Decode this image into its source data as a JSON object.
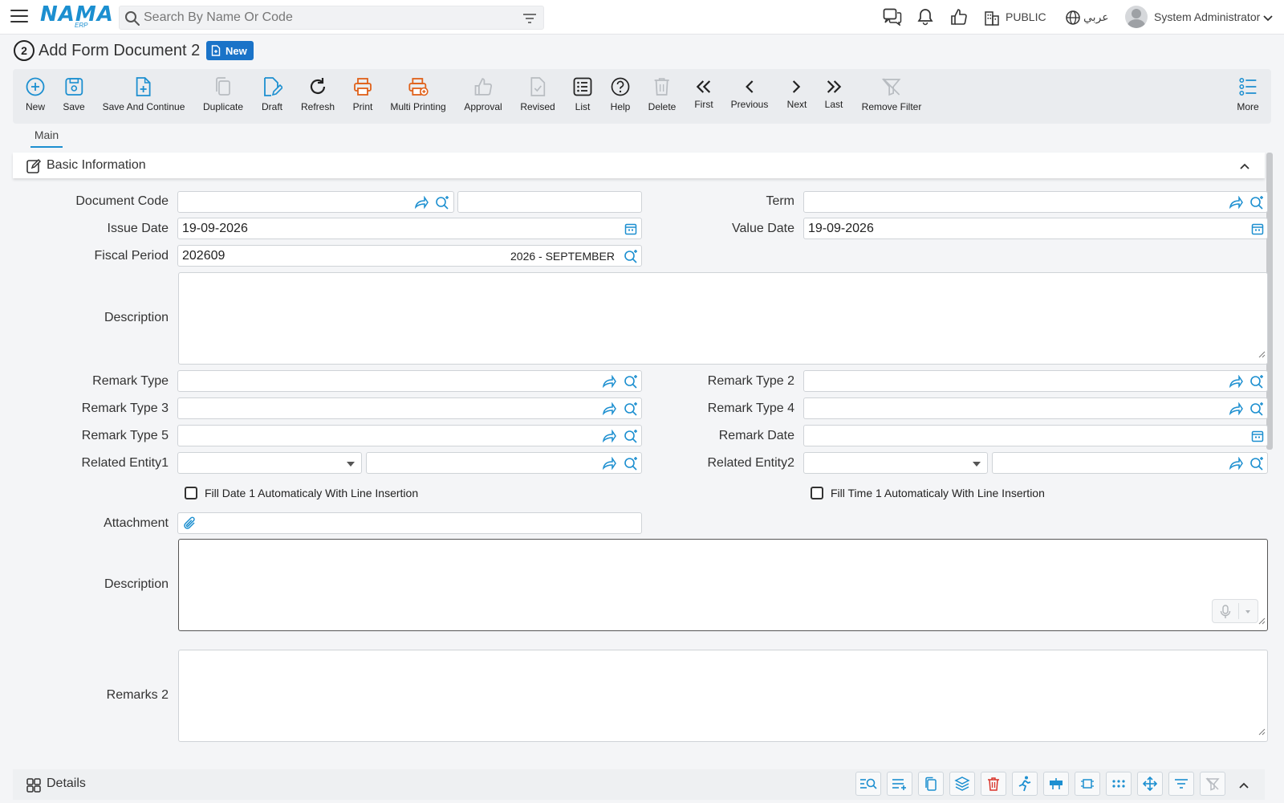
{
  "app": {
    "logo": "NAMA",
    "logo_sub": "ERP"
  },
  "search": {
    "placeholder": "Search By Name Or Code"
  },
  "header": {
    "branch": "PUBLIC",
    "language": "عربي",
    "user": "System Administrator"
  },
  "page": {
    "number": "2",
    "title": "Add Form Document 2",
    "status_badge": "New"
  },
  "toolbar": {
    "new": "New",
    "save": "Save",
    "save_continue": "Save And Continue",
    "duplicate": "Duplicate",
    "draft": "Draft",
    "refresh": "Refresh",
    "print": "Print",
    "multi_printing": "Multi Printing",
    "approval": "Approval",
    "revised": "Revised",
    "list": "List",
    "help": "Help",
    "delete": "Delete",
    "first": "First",
    "previous": "Previous",
    "next": "Next",
    "last": "Last",
    "remove_filter": "Remove Filter",
    "more": "More"
  },
  "tabs": {
    "main": "Main"
  },
  "section": {
    "title": "Basic Information"
  },
  "form": {
    "document_code": {
      "label": "Document Code",
      "value": "",
      "name_value": ""
    },
    "term": {
      "label": "Term",
      "value": ""
    },
    "issue_date": {
      "label": "Issue Date",
      "value": "19-09-2026"
    },
    "value_date": {
      "label": "Value Date",
      "value": "19-09-2026"
    },
    "fiscal_period": {
      "label": "Fiscal Period",
      "value": "202609",
      "name": "2026 - SEPTEMBER"
    },
    "description": {
      "label": "Description",
      "value": ""
    },
    "remark_type": {
      "label": "Remark Type",
      "value": ""
    },
    "remark_type_2": {
      "label": "Remark Type 2",
      "value": ""
    },
    "remark_type_3": {
      "label": "Remark Type 3",
      "value": ""
    },
    "remark_type_4": {
      "label": "Remark Type 4",
      "value": ""
    },
    "remark_type_5": {
      "label": "Remark Type 5",
      "value": ""
    },
    "remark_date": {
      "label": "Remark Date",
      "value": ""
    },
    "related_entity1": {
      "label": "Related Entity1",
      "type_value": "",
      "value": ""
    },
    "related_entity2": {
      "label": "Related Entity2",
      "type_value": "",
      "value": ""
    },
    "fill_date_1": {
      "label": "Fill Date 1 Automaticaly With Line Insertion",
      "checked": false
    },
    "fill_time_1": {
      "label": "Fill Time 1 Automaticaly With Line Insertion",
      "checked": false
    },
    "attachment": {
      "label": "Attachment",
      "value": ""
    },
    "description_2": {
      "label": "Description",
      "value": ""
    },
    "remarks_2": {
      "label": "Remarks 2",
      "value": ""
    }
  },
  "details": {
    "title": "Details"
  },
  "colors": {
    "accent": "#1c8fd0",
    "print": "#e0611a",
    "danger": "#d9342b",
    "disabled": "#b8bcc1"
  }
}
